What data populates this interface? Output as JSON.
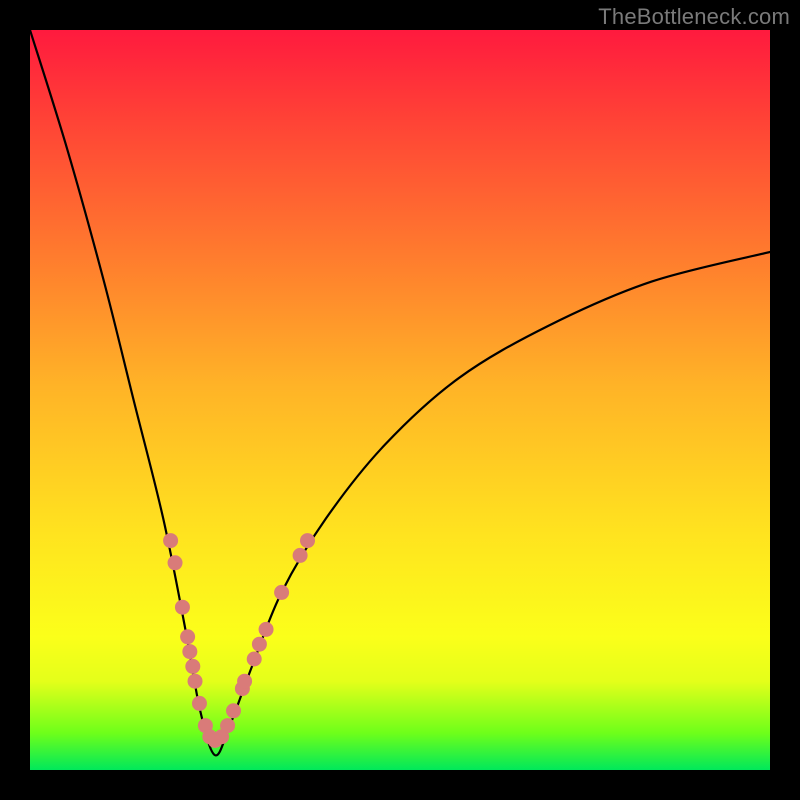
{
  "watermark": "TheBottleneck.com",
  "colors": {
    "gradient_top": "#ff1a3e",
    "gradient_mid_high": "#ff7a2e",
    "gradient_mid": "#ffe31f",
    "gradient_low": "#6eff1a",
    "gradient_bottom": "#00e85b",
    "curve": "#000000",
    "dots": "#d97b79",
    "frame": "#000000"
  },
  "chart_data": {
    "type": "line",
    "title": "",
    "xlabel": "",
    "ylabel": "",
    "xlim": [
      0,
      100
    ],
    "ylim": [
      0,
      100
    ],
    "notes": "V-shaped bottleneck curve. Minimum (≈0%) is at x≈25. Left branch rises steeply from the top-left corner (near 100%) down to the minimum. Right branch rises more gently from the minimum toward ~70% at the right edge. Salmon dots cluster on both branches roughly between y≈4 and y≈32.",
    "series": [
      {
        "name": "bottleneck-curve",
        "x": [
          0,
          5,
          10,
          14,
          18,
          21,
          23,
          25,
          27,
          30,
          34,
          40,
          48,
          58,
          70,
          84,
          100
        ],
        "y": [
          100,
          84,
          66,
          50,
          34,
          19,
          8,
          2,
          6,
          14,
          24,
          34,
          44,
          53,
          60,
          66,
          70
        ]
      }
    ],
    "points": [
      {
        "name": "dot",
        "x": 19.0,
        "y": 31
      },
      {
        "name": "dot",
        "x": 19.6,
        "y": 28
      },
      {
        "name": "dot",
        "x": 20.6,
        "y": 22
      },
      {
        "name": "dot",
        "x": 21.3,
        "y": 18
      },
      {
        "name": "dot",
        "x": 21.6,
        "y": 16
      },
      {
        "name": "dot",
        "x": 22.0,
        "y": 14
      },
      {
        "name": "dot",
        "x": 22.3,
        "y": 12
      },
      {
        "name": "dot",
        "x": 22.9,
        "y": 9
      },
      {
        "name": "dot",
        "x": 23.7,
        "y": 6
      },
      {
        "name": "dot",
        "x": 24.3,
        "y": 4.5
      },
      {
        "name": "dot",
        "x": 25.0,
        "y": 4
      },
      {
        "name": "dot",
        "x": 25.9,
        "y": 4.5
      },
      {
        "name": "dot",
        "x": 26.7,
        "y": 6
      },
      {
        "name": "dot",
        "x": 27.5,
        "y": 8
      },
      {
        "name": "dot",
        "x": 28.7,
        "y": 11
      },
      {
        "name": "dot",
        "x": 29.0,
        "y": 12
      },
      {
        "name": "dot",
        "x": 30.3,
        "y": 15
      },
      {
        "name": "dot",
        "x": 31.0,
        "y": 17
      },
      {
        "name": "dot",
        "x": 31.9,
        "y": 19
      },
      {
        "name": "dot",
        "x": 34.0,
        "y": 24
      },
      {
        "name": "dot",
        "x": 36.5,
        "y": 29
      },
      {
        "name": "dot",
        "x": 37.5,
        "y": 31
      }
    ]
  }
}
